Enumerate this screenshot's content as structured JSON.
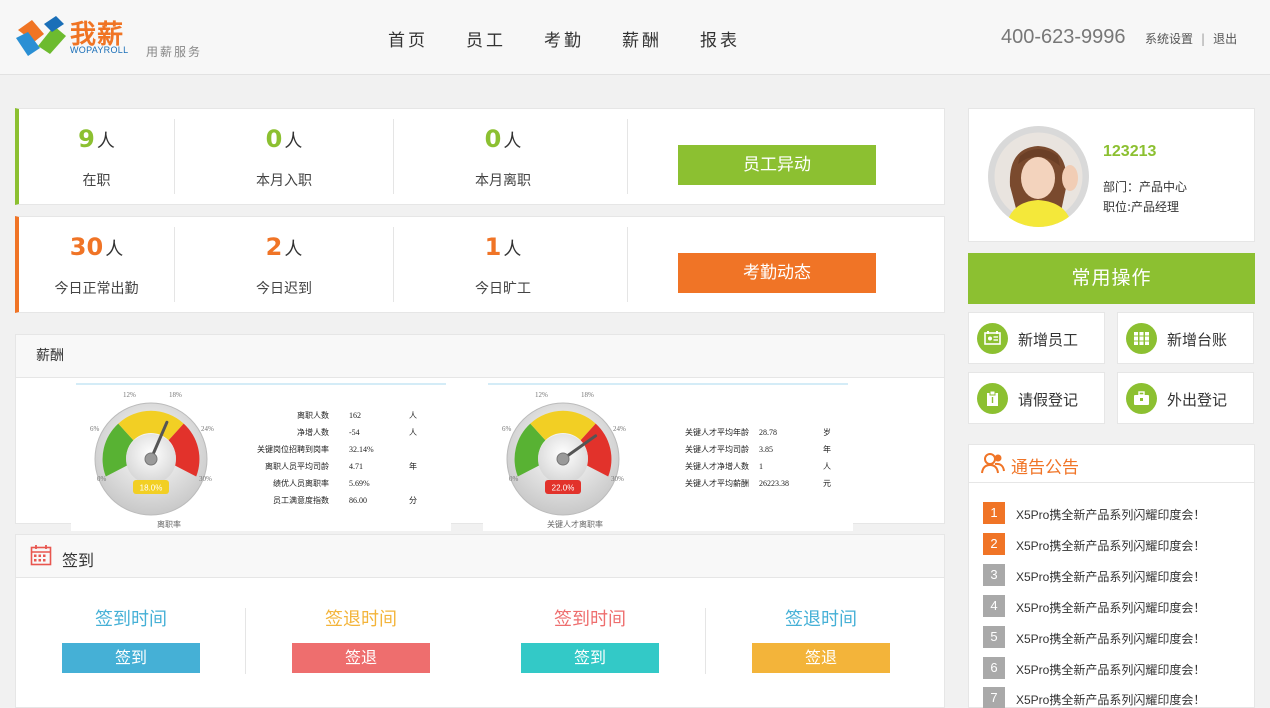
{
  "header": {
    "logo_text": "我薪",
    "logo_sub": "WOPAYROLL",
    "logo_tagline": "用薪服务",
    "nav": [
      "首页",
      "员工",
      "考勤",
      "薪酬",
      "报表"
    ],
    "phone": "400-623-9996",
    "settings": "系统设置",
    "separator": "|",
    "logout": "退出"
  },
  "staff_card": {
    "stats": [
      {
        "num": "9",
        "unit": "人",
        "label": "在职"
      },
      {
        "num": "0",
        "unit": "人",
        "label": "本月入职"
      },
      {
        "num": "0",
        "unit": "人",
        "label": "本月离职"
      }
    ],
    "button": "员工异动",
    "accent": "#8cc031"
  },
  "attendance_card": {
    "stats": [
      {
        "num": "30",
        "unit": "人",
        "label": "今日正常出勤"
      },
      {
        "num": "2",
        "unit": "人",
        "label": "今日迟到"
      },
      {
        "num": "1",
        "unit": "人",
        "label": "今日旷工"
      }
    ],
    "button": "考勤动态",
    "accent": "#f07426"
  },
  "salary": {
    "title": "薪酬",
    "gauges": [
      {
        "readout": "18.0%",
        "value": 18.0,
        "ticks": [
          "0%",
          "6%",
          "12%",
          "18%",
          "24%",
          "30%"
        ],
        "caption": "离职率",
        "stats": [
          {
            "k": "离职人数",
            "v": "162",
            "u": "人"
          },
          {
            "k": "净增人数",
            "v": "-54",
            "u": "人"
          },
          {
            "k": "关键岗位招聘到岗率",
            "v": "32.14%",
            "u": ""
          },
          {
            "k": "离职人员平均司龄",
            "v": "4.71",
            "u": "年"
          },
          {
            "k": "绩优人员离职率",
            "v": "5.69%",
            "u": ""
          },
          {
            "k": "员工满意度指数",
            "v": "86.00",
            "u": "分"
          }
        ]
      },
      {
        "readout": "22.0%",
        "value": 22.0,
        "ticks": [
          "0%",
          "6%",
          "12%",
          "18%",
          "24%",
          "30%"
        ],
        "caption": "关键人才离职率",
        "stats": [
          {
            "k": "关键人才平均年龄",
            "v": "28.78",
            "u": "岁"
          },
          {
            "k": "关键人才平均司龄",
            "v": "3.85",
            "u": "年"
          },
          {
            "k": "关键人才净增人数",
            "v": "1",
            "u": "人"
          },
          {
            "k": "关键人才平均薪酬",
            "v": "26223.38",
            "u": "元"
          }
        ]
      }
    ]
  },
  "sign": {
    "title": "签到",
    "items": [
      {
        "time": "签到时间",
        "button": "签到",
        "color": "#45b0d6"
      },
      {
        "time": "签退时间",
        "button": "签退",
        "color": "#ee6e6e"
      },
      {
        "time": "签到时间",
        "button": "签到",
        "color": "#33c9c7"
      },
      {
        "time": "签退时间",
        "button": "签退",
        "color": "#f3b43a"
      }
    ],
    "time_colors": [
      "#45b0d6",
      "#f3b43a",
      "#ee6e6e",
      "#45b0d6"
    ]
  },
  "profile": {
    "name": "123213",
    "dept": "部门：产品中心",
    "position": "职位:产品经理"
  },
  "ops": {
    "title": "常用操作",
    "items": [
      {
        "label": "新增员工",
        "icon": "id-card-icon"
      },
      {
        "label": "新增台账",
        "icon": "ledger-icon"
      },
      {
        "label": "请假登记",
        "icon": "clipboard-icon"
      },
      {
        "label": "外出登记",
        "icon": "briefcase-icon"
      }
    ]
  },
  "notice": {
    "title": "通告公告",
    "items": [
      {
        "idx": "1",
        "text": "X5Pro携全新产品系列闪耀印度会！",
        "color": "#f07426"
      },
      {
        "idx": "2",
        "text": "X5Pro携全新产品系列闪耀印度会！",
        "color": "#f07426"
      },
      {
        "idx": "3",
        "text": "X5Pro携全新产品系列闪耀印度会！",
        "color": "#a9a9a9"
      },
      {
        "idx": "4",
        "text": "X5Pro携全新产品系列闪耀印度会！",
        "color": "#a9a9a9"
      },
      {
        "idx": "5",
        "text": "X5Pro携全新产品系列闪耀印度会！",
        "color": "#a9a9a9"
      },
      {
        "idx": "6",
        "text": "X5Pro携全新产品系列闪耀印度会！",
        "color": "#a9a9a9"
      },
      {
        "idx": "7",
        "text": "X5Pro携全新产品系列闪耀印度会！",
        "color": "#a9a9a9"
      }
    ]
  }
}
